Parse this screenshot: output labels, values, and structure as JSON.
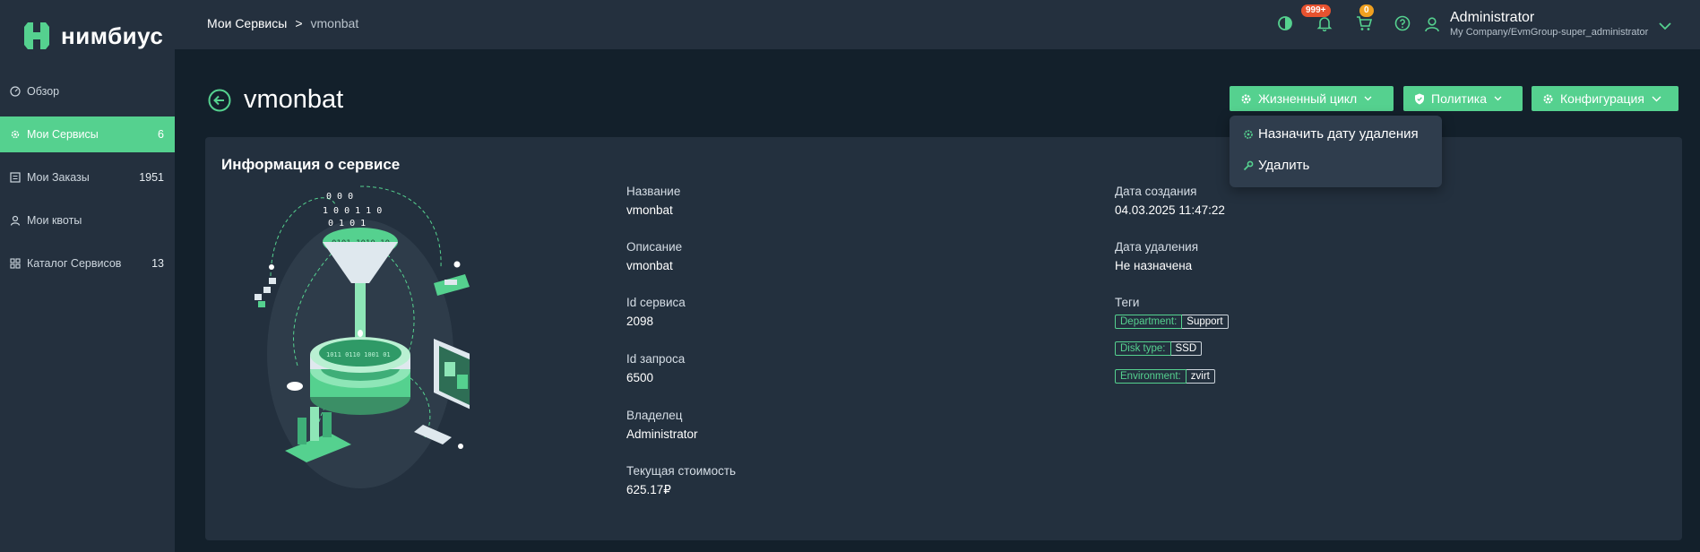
{
  "app": {
    "logo_text": "нимбиус"
  },
  "sidebar": {
    "items": [
      {
        "label": "Обзор",
        "count": ""
      },
      {
        "label": "Мои Сервисы",
        "count": "6"
      },
      {
        "label": "Мои Заказы",
        "count": "1951"
      },
      {
        "label": "Мои квоты",
        "count": ""
      },
      {
        "label": "Каталог Сервисов",
        "count": "13"
      }
    ]
  },
  "header": {
    "breadcrumb": [
      "Мои Сервисы",
      "vmonbat"
    ],
    "breadcrumb_sep": ">",
    "notifications_badge": "999+",
    "cart_badge": "0",
    "user_name": "Administrator",
    "user_org": "My Company/EvmGroup-super_administrator"
  },
  "page": {
    "title": "vmonbat",
    "buttons": [
      "Жизненный цикл",
      "Политика",
      "Конфигурация"
    ],
    "lifecycle_menu": [
      "Назначить дату удаления",
      "Удалить"
    ]
  },
  "card": {
    "title": "Информация о сервисе",
    "left_fields": [
      {
        "label": "Название",
        "value": "vmonbat"
      },
      {
        "label": "Описание",
        "value": "vmonbat"
      },
      {
        "label": "Id сервиса",
        "value": "2098"
      },
      {
        "label": "Id запроса",
        "value": "6500"
      },
      {
        "label": "Владелец",
        "value": "Administrator"
      },
      {
        "label": "Текущая стоимость",
        "value": "625.17₽"
      }
    ],
    "right_fields": [
      {
        "label": "Дата создания",
        "value": "04.03.2025 11:47:22"
      },
      {
        "label": "Дата удаления",
        "value": "Не назначена"
      }
    ],
    "tags_label": "Теги",
    "tags": [
      {
        "key": "Department:",
        "value": "Support"
      },
      {
        "key": "Disk type:",
        "value": "SSD"
      },
      {
        "key": "Environment:",
        "value": "zvirt"
      }
    ]
  },
  "colors": {
    "accent": "#55d18f",
    "sidebar": "#24303e",
    "background": "#13202b",
    "card": "#23303e",
    "badge_red": "#e8522f",
    "badge_orange": "#f0a020"
  }
}
